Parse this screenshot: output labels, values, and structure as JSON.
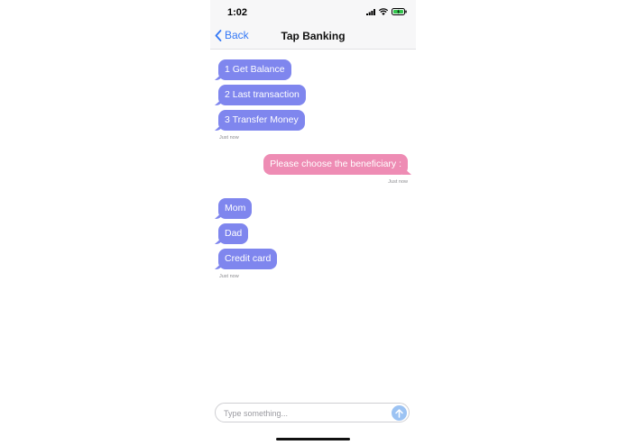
{
  "status_bar": {
    "time": "1:02",
    "icons": [
      "signal-icon",
      "wifi-icon",
      "battery-charging-icon"
    ]
  },
  "nav": {
    "back_label": "Back",
    "title": "Tap Banking",
    "back_icon": "chevron-left-icon"
  },
  "messages": [
    {
      "sender": "bot",
      "text": "1 Get Balance"
    },
    {
      "sender": "bot",
      "text": "2 Last transaction"
    },
    {
      "sender": "bot",
      "text": "3 Transfer Money"
    },
    {
      "sender": "user",
      "text": "Please choose the beneficiary :"
    },
    {
      "sender": "bot",
      "text": "Mom"
    },
    {
      "sender": "bot",
      "text": "Dad"
    },
    {
      "sender": "bot",
      "text": "Credit card"
    }
  ],
  "timestamps": [
    "Just now",
    "Just now",
    "Just now"
  ],
  "composer": {
    "placeholder": "Type something...",
    "value": "",
    "send_icon": "arrow-up-icon"
  },
  "colors": {
    "bot_bubble": "#7f86ee",
    "user_bubble": "#ee8cb4",
    "accent": "#3478f6",
    "send_button": "#9cc3f3"
  }
}
